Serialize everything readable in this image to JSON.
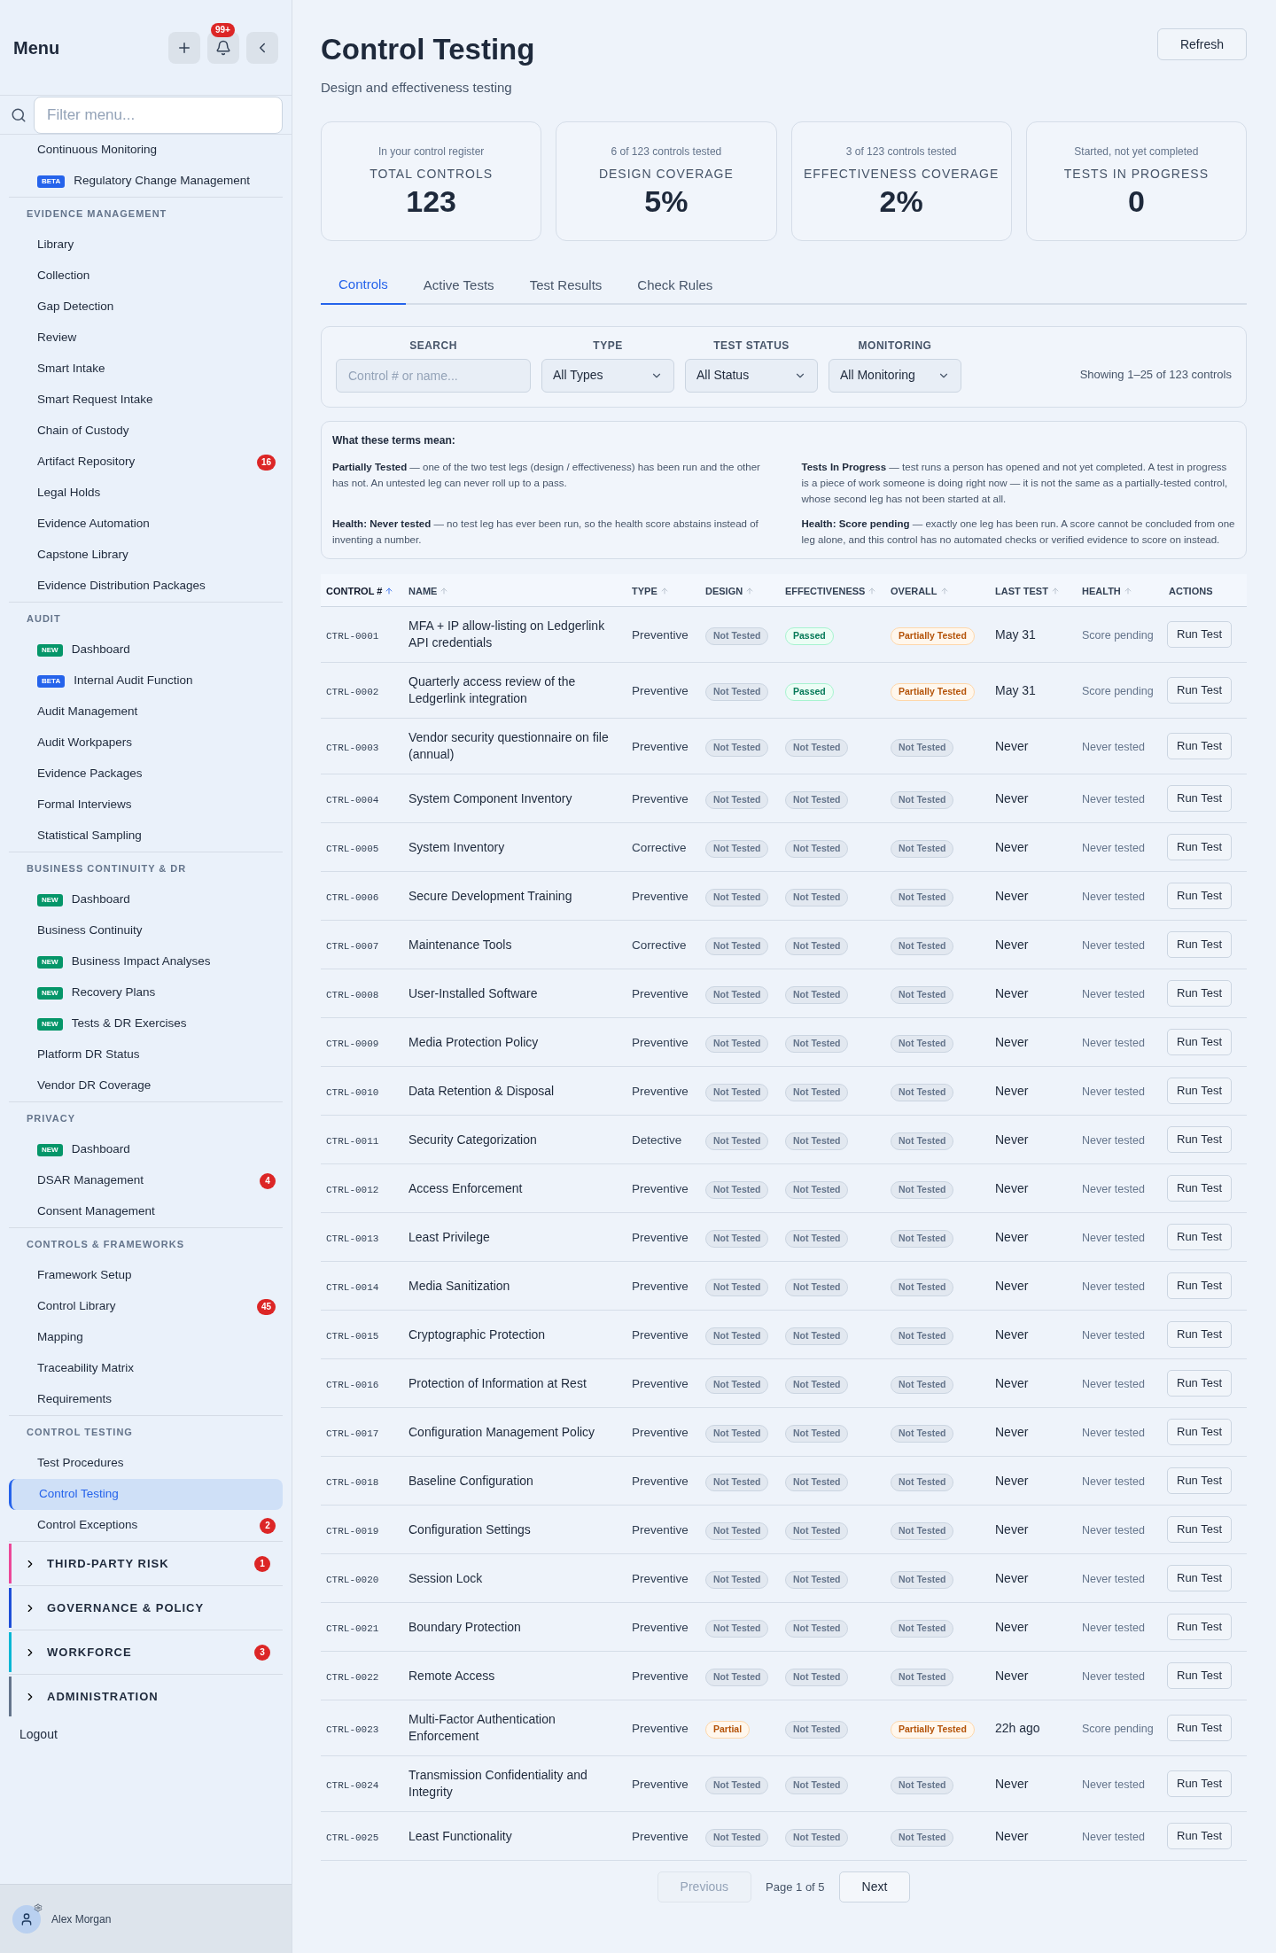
{
  "sidebar": {
    "title": "Menu",
    "notification_badge": "99+",
    "filter": {
      "placeholder": "Filter menu..."
    },
    "sections": [
      {
        "items": [
          {
            "label": "Continuous Monitoring",
            "selected": false
          },
          {
            "label": "Regulatory Change Management",
            "tag": {
              "text": "BETA",
              "kind": "beta"
            },
            "selected": false
          }
        ]
      },
      {
        "heading": "EVIDENCE MANAGEMENT",
        "items": [
          {
            "label": "Library",
            "selected": false
          },
          {
            "label": "Collection",
            "selected": false
          },
          {
            "label": "Gap Detection",
            "selected": false
          },
          {
            "label": "Review",
            "selected": false
          },
          {
            "label": "Smart Intake",
            "selected": false
          },
          {
            "label": "Smart Request Intake",
            "selected": false
          },
          {
            "label": "Chain of Custody",
            "selected": false
          },
          {
            "label": "Artifact Repository",
            "badge": "16",
            "selected": false
          },
          {
            "label": "Legal Holds",
            "selected": false
          },
          {
            "label": "Evidence Automation",
            "selected": false
          },
          {
            "label": "Capstone Library",
            "selected": false
          },
          {
            "label": "Evidence Distribution Packages",
            "selected": false
          }
        ]
      },
      {
        "heading": "AUDIT",
        "items": [
          {
            "label": "Dashboard",
            "tag": {
              "text": "NEW",
              "kind": "new"
            },
            "selected": false
          },
          {
            "label": "Internal Audit Function",
            "tag": {
              "text": "BETA",
              "kind": "beta"
            },
            "selected": false
          },
          {
            "label": "Audit Management",
            "selected": false
          },
          {
            "label": "Audit Workpapers",
            "selected": false
          },
          {
            "label": "Evidence Packages",
            "selected": false
          },
          {
            "label": "Formal Interviews",
            "selected": false
          },
          {
            "label": "Statistical Sampling",
            "selected": false
          }
        ]
      },
      {
        "heading": "BUSINESS CONTINUITY & DR",
        "items": [
          {
            "label": "Dashboard",
            "tag": {
              "text": "NEW",
              "kind": "new"
            },
            "selected": false
          },
          {
            "label": "Business Continuity",
            "selected": false
          },
          {
            "label": "Business Impact Analyses",
            "tag": {
              "text": "NEW",
              "kind": "new"
            },
            "selected": false
          },
          {
            "label": "Recovery Plans",
            "tag": {
              "text": "NEW",
              "kind": "new"
            },
            "selected": false
          },
          {
            "label": "Tests & DR Exercises",
            "tag": {
              "text": "NEW",
              "kind": "new"
            },
            "selected": false
          },
          {
            "label": "Platform DR Status",
            "selected": false
          },
          {
            "label": "Vendor DR Coverage",
            "selected": false
          }
        ]
      },
      {
        "heading": "PRIVACY",
        "items": [
          {
            "label": "Dashboard",
            "tag": {
              "text": "NEW",
              "kind": "new"
            },
            "selected": false
          },
          {
            "label": "DSAR Management",
            "badge": "4",
            "selected": false
          },
          {
            "label": "Consent Management",
            "selected": false
          }
        ]
      },
      {
        "heading": "CONTROLS & FRAMEWORKS",
        "items": [
          {
            "label": "Framework Setup",
            "selected": false
          },
          {
            "label": "Control Library",
            "badge": "45",
            "selected": false
          },
          {
            "label": "Mapping",
            "selected": false
          },
          {
            "label": "Traceability Matrix",
            "selected": false
          },
          {
            "label": "Requirements",
            "selected": false
          }
        ]
      },
      {
        "heading": "CONTROL TESTING",
        "items": [
          {
            "label": "Test Procedures",
            "selected": false
          },
          {
            "label": "Control Testing",
            "selected": true
          },
          {
            "label": "Control Exceptions",
            "badge": "2",
            "selected": false
          }
        ]
      }
    ],
    "groups": [
      {
        "label": "THIRD-PARTY RISK",
        "color": "#ec4899",
        "badge": "1",
        "expanded": false
      },
      {
        "label": "GOVERNANCE & POLICY",
        "color": "#1d4ed8",
        "expanded": false
      },
      {
        "label": "WORKFORCE",
        "color": "#06b6d4",
        "badge": "3",
        "expanded": false
      },
      {
        "label": "ADMINISTRATION",
        "color": "#64748b",
        "expanded": false
      }
    ],
    "logout": "Logout",
    "user": "Alex Morgan"
  },
  "header": {
    "title": "Control Testing",
    "subtitle": "Design and effectiveness testing",
    "refresh": "Refresh"
  },
  "stats": [
    {
      "caption": "In your control register",
      "label": "TOTAL CONTROLS",
      "value": "123"
    },
    {
      "caption": "6 of 123 controls tested",
      "label": "DESIGN COVERAGE",
      "value": "5%"
    },
    {
      "caption": "3 of 123 controls tested",
      "label": "EFFECTIVENESS COVERAGE",
      "value": "2%"
    },
    {
      "caption": "Started, not yet completed",
      "label": "TESTS IN PROGRESS",
      "value": "0"
    }
  ],
  "tabs": [
    {
      "label": "Controls",
      "selected": true
    },
    {
      "label": "Active Tests",
      "selected": false
    },
    {
      "label": "Test Results",
      "selected": false
    },
    {
      "label": "Check Rules",
      "selected": false
    }
  ],
  "filters": {
    "search": {
      "label": "SEARCH",
      "placeholder": "Control # or name..."
    },
    "selects": [
      {
        "label": "TYPE",
        "value": "All Types"
      },
      {
        "label": "TEST STATUS",
        "value": "All Status"
      },
      {
        "label": "MONITORING",
        "value": "All Monitoring"
      }
    ],
    "showing": "Showing 1–25 of 123 controls"
  },
  "legend": {
    "title": "What these terms mean:",
    "entries": [
      "**Partially Tested** — one of the two test legs (design / effectiveness) has been run and the other has not. An untested leg can never roll up to a pass.",
      "**Tests In Progress** — test runs a person has opened and not yet completed. A test in progress is a piece of work someone is doing right now — it is not the same as a partially-tested control, whose second leg has not been started at all.",
      "**Health: Never tested** — no test leg has ever been run, so the health score abstains instead of inventing a number.",
      "**Health: Score pending** — exactly one leg has been run. A score cannot be concluded from one leg alone, and this control has no automated checks or verified evidence to score on instead."
    ]
  },
  "table": {
    "columns": [
      {
        "label": "CONTROL #",
        "sortable": true,
        "sorted": true
      },
      {
        "label": "NAME",
        "sortable": true,
        "sorted": false
      },
      {
        "label": "TYPE",
        "sortable": true,
        "sorted": false
      },
      {
        "label": "DESIGN",
        "sortable": true,
        "sorted": false
      },
      {
        "label": "EFFECTIVENESS",
        "sortable": true,
        "sorted": false
      },
      {
        "label": "OVERALL",
        "sortable": true,
        "sorted": false
      },
      {
        "label": "LAST TEST",
        "sortable": true,
        "sorted": false
      },
      {
        "label": "HEALTH",
        "sortable": true,
        "sorted": false
      },
      {
        "label": "ACTIONS",
        "sortable": false,
        "sorted": false
      }
    ],
    "rows": [
      {
        "id": "CTRL-0001",
        "name": "MFA + IP allow-listing on Ledgerlink API credentials",
        "type": "Preventive",
        "design": {
          "text": "Not Tested",
          "kind": "not_tested"
        },
        "effectiveness": {
          "text": "Passed",
          "kind": "passed"
        },
        "overall": {
          "text": "Partially Tested",
          "kind": "partial"
        },
        "last_test": "May 31",
        "health": "Score pending",
        "action": "Run Test"
      },
      {
        "id": "CTRL-0002",
        "name": "Quarterly access review of the Ledgerlink integration",
        "type": "Preventive",
        "design": {
          "text": "Not Tested",
          "kind": "not_tested"
        },
        "effectiveness": {
          "text": "Passed",
          "kind": "passed"
        },
        "overall": {
          "text": "Partially Tested",
          "kind": "partial"
        },
        "last_test": "May 31",
        "health": "Score pending",
        "action": "Run Test"
      },
      {
        "id": "CTRL-0003",
        "name": "Vendor security questionnaire on file (annual)",
        "type": "Preventive",
        "design": {
          "text": "Not Tested",
          "kind": "not_tested"
        },
        "effectiveness": {
          "text": "Not Tested",
          "kind": "not_tested"
        },
        "overall": {
          "text": "Not Tested",
          "kind": "not_tested"
        },
        "last_test": "Never",
        "health": "Never tested",
        "action": "Run Test"
      },
      {
        "id": "CTRL-0004",
        "name": "System Component Inventory",
        "type": "Preventive",
        "design": {
          "text": "Not Tested",
          "kind": "not_tested"
        },
        "effectiveness": {
          "text": "Not Tested",
          "kind": "not_tested"
        },
        "overall": {
          "text": "Not Tested",
          "kind": "not_tested"
        },
        "last_test": "Never",
        "health": "Never tested",
        "action": "Run Test"
      },
      {
        "id": "CTRL-0005",
        "name": "System Inventory",
        "type": "Corrective",
        "design": {
          "text": "Not Tested",
          "kind": "not_tested"
        },
        "effectiveness": {
          "text": "Not Tested",
          "kind": "not_tested"
        },
        "overall": {
          "text": "Not Tested",
          "kind": "not_tested"
        },
        "last_test": "Never",
        "health": "Never tested",
        "action": "Run Test"
      },
      {
        "id": "CTRL-0006",
        "name": "Secure Development Training",
        "type": "Preventive",
        "design": {
          "text": "Not Tested",
          "kind": "not_tested"
        },
        "effectiveness": {
          "text": "Not Tested",
          "kind": "not_tested"
        },
        "overall": {
          "text": "Not Tested",
          "kind": "not_tested"
        },
        "last_test": "Never",
        "health": "Never tested",
        "action": "Run Test"
      },
      {
        "id": "CTRL-0007",
        "name": "Maintenance Tools",
        "type": "Corrective",
        "design": {
          "text": "Not Tested",
          "kind": "not_tested"
        },
        "effectiveness": {
          "text": "Not Tested",
          "kind": "not_tested"
        },
        "overall": {
          "text": "Not Tested",
          "kind": "not_tested"
        },
        "last_test": "Never",
        "health": "Never tested",
        "action": "Run Test"
      },
      {
        "id": "CTRL-0008",
        "name": "User-Installed Software",
        "type": "Preventive",
        "design": {
          "text": "Not Tested",
          "kind": "not_tested"
        },
        "effectiveness": {
          "text": "Not Tested",
          "kind": "not_tested"
        },
        "overall": {
          "text": "Not Tested",
          "kind": "not_tested"
        },
        "last_test": "Never",
        "health": "Never tested",
        "action": "Run Test"
      },
      {
        "id": "CTRL-0009",
        "name": "Media Protection Policy",
        "type": "Preventive",
        "design": {
          "text": "Not Tested",
          "kind": "not_tested"
        },
        "effectiveness": {
          "text": "Not Tested",
          "kind": "not_tested"
        },
        "overall": {
          "text": "Not Tested",
          "kind": "not_tested"
        },
        "last_test": "Never",
        "health": "Never tested",
        "action": "Run Test"
      },
      {
        "id": "CTRL-0010",
        "name": "Data Retention & Disposal",
        "type": "Preventive",
        "design": {
          "text": "Not Tested",
          "kind": "not_tested"
        },
        "effectiveness": {
          "text": "Not Tested",
          "kind": "not_tested"
        },
        "overall": {
          "text": "Not Tested",
          "kind": "not_tested"
        },
        "last_test": "Never",
        "health": "Never tested",
        "action": "Run Test"
      },
      {
        "id": "CTRL-0011",
        "name": "Security Categorization",
        "type": "Detective",
        "design": {
          "text": "Not Tested",
          "kind": "not_tested"
        },
        "effectiveness": {
          "text": "Not Tested",
          "kind": "not_tested"
        },
        "overall": {
          "text": "Not Tested",
          "kind": "not_tested"
        },
        "last_test": "Never",
        "health": "Never tested",
        "action": "Run Test"
      },
      {
        "id": "CTRL-0012",
        "name": "Access Enforcement",
        "type": "Preventive",
        "design": {
          "text": "Not Tested",
          "kind": "not_tested"
        },
        "effectiveness": {
          "text": "Not Tested",
          "kind": "not_tested"
        },
        "overall": {
          "text": "Not Tested",
          "kind": "not_tested"
        },
        "last_test": "Never",
        "health": "Never tested",
        "action": "Run Test"
      },
      {
        "id": "CTRL-0013",
        "name": "Least Privilege",
        "type": "Preventive",
        "design": {
          "text": "Not Tested",
          "kind": "not_tested"
        },
        "effectiveness": {
          "text": "Not Tested",
          "kind": "not_tested"
        },
        "overall": {
          "text": "Not Tested",
          "kind": "not_tested"
        },
        "last_test": "Never",
        "health": "Never tested",
        "action": "Run Test"
      },
      {
        "id": "CTRL-0014",
        "name": "Media Sanitization",
        "type": "Preventive",
        "design": {
          "text": "Not Tested",
          "kind": "not_tested"
        },
        "effectiveness": {
          "text": "Not Tested",
          "kind": "not_tested"
        },
        "overall": {
          "text": "Not Tested",
          "kind": "not_tested"
        },
        "last_test": "Never",
        "health": "Never tested",
        "action": "Run Test"
      },
      {
        "id": "CTRL-0015",
        "name": "Cryptographic Protection",
        "type": "Preventive",
        "design": {
          "text": "Not Tested",
          "kind": "not_tested"
        },
        "effectiveness": {
          "text": "Not Tested",
          "kind": "not_tested"
        },
        "overall": {
          "text": "Not Tested",
          "kind": "not_tested"
        },
        "last_test": "Never",
        "health": "Never tested",
        "action": "Run Test"
      },
      {
        "id": "CTRL-0016",
        "name": "Protection of Information at Rest",
        "type": "Preventive",
        "design": {
          "text": "Not Tested",
          "kind": "not_tested"
        },
        "effectiveness": {
          "text": "Not Tested",
          "kind": "not_tested"
        },
        "overall": {
          "text": "Not Tested",
          "kind": "not_tested"
        },
        "last_test": "Never",
        "health": "Never tested",
        "action": "Run Test"
      },
      {
        "id": "CTRL-0017",
        "name": "Configuration Management Policy",
        "type": "Preventive",
        "design": {
          "text": "Not Tested",
          "kind": "not_tested"
        },
        "effectiveness": {
          "text": "Not Tested",
          "kind": "not_tested"
        },
        "overall": {
          "text": "Not Tested",
          "kind": "not_tested"
        },
        "last_test": "Never",
        "health": "Never tested",
        "action": "Run Test"
      },
      {
        "id": "CTRL-0018",
        "name": "Baseline Configuration",
        "type": "Preventive",
        "design": {
          "text": "Not Tested",
          "kind": "not_tested"
        },
        "effectiveness": {
          "text": "Not Tested",
          "kind": "not_tested"
        },
        "overall": {
          "text": "Not Tested",
          "kind": "not_tested"
        },
        "last_test": "Never",
        "health": "Never tested",
        "action": "Run Test"
      },
      {
        "id": "CTRL-0019",
        "name": "Configuration Settings",
        "type": "Preventive",
        "design": {
          "text": "Not Tested",
          "kind": "not_tested"
        },
        "effectiveness": {
          "text": "Not Tested",
          "kind": "not_tested"
        },
        "overall": {
          "text": "Not Tested",
          "kind": "not_tested"
        },
        "last_test": "Never",
        "health": "Never tested",
        "action": "Run Test"
      },
      {
        "id": "CTRL-0020",
        "name": "Session Lock",
        "type": "Preventive",
        "design": {
          "text": "Not Tested",
          "kind": "not_tested"
        },
        "effectiveness": {
          "text": "Not Tested",
          "kind": "not_tested"
        },
        "overall": {
          "text": "Not Tested",
          "kind": "not_tested"
        },
        "last_test": "Never",
        "health": "Never tested",
        "action": "Run Test"
      },
      {
        "id": "CTRL-0021",
        "name": "Boundary Protection",
        "type": "Preventive",
        "design": {
          "text": "Not Tested",
          "kind": "not_tested"
        },
        "effectiveness": {
          "text": "Not Tested",
          "kind": "not_tested"
        },
        "overall": {
          "text": "Not Tested",
          "kind": "not_tested"
        },
        "last_test": "Never",
        "health": "Never tested",
        "action": "Run Test"
      },
      {
        "id": "CTRL-0022",
        "name": "Remote Access",
        "type": "Preventive",
        "design": {
          "text": "Not Tested",
          "kind": "not_tested"
        },
        "effectiveness": {
          "text": "Not Tested",
          "kind": "not_tested"
        },
        "overall": {
          "text": "Not Tested",
          "kind": "not_tested"
        },
        "last_test": "Never",
        "health": "Never tested",
        "action": "Run Test"
      },
      {
        "id": "CTRL-0023",
        "name": "Multi-Factor Authentication Enforcement",
        "type": "Preventive",
        "design": {
          "text": "Partial",
          "kind": "partial"
        },
        "effectiveness": {
          "text": "Not Tested",
          "kind": "not_tested"
        },
        "overall": {
          "text": "Partially Tested",
          "kind": "partial"
        },
        "last_test": "22h ago",
        "health": "Score pending",
        "action": "Run Test"
      },
      {
        "id": "CTRL-0024",
        "name": "Transmission Confidentiality and Integrity",
        "type": "Preventive",
        "design": {
          "text": "Not Tested",
          "kind": "not_tested"
        },
        "effectiveness": {
          "text": "Not Tested",
          "kind": "not_tested"
        },
        "overall": {
          "text": "Not Tested",
          "kind": "not_tested"
        },
        "last_test": "Never",
        "health": "Never tested",
        "action": "Run Test"
      },
      {
        "id": "CTRL-0025",
        "name": "Least Functionality",
        "type": "Preventive",
        "design": {
          "text": "Not Tested",
          "kind": "not_tested"
        },
        "effectiveness": {
          "text": "Not Tested",
          "kind": "not_tested"
        },
        "overall": {
          "text": "Not Tested",
          "kind": "not_tested"
        },
        "last_test": "Never",
        "health": "Never tested",
        "action": "Run Test"
      }
    ]
  },
  "pagination": {
    "previous": {
      "label": "Previous",
      "disabled": true
    },
    "page": "Page 1 of 5",
    "next": {
      "label": "Next",
      "disabled": false
    }
  }
}
